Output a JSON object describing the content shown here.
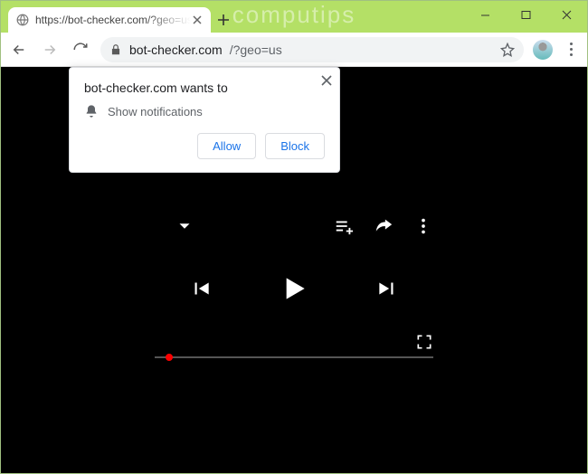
{
  "window": {
    "watermark": "computips"
  },
  "tab": {
    "title": "https://bot-checker.com/?geo=us"
  },
  "address": {
    "host": "bot-checker.com",
    "path": "/?geo=us"
  },
  "prompt": {
    "origin": "bot-checker.com wants to",
    "permission": "Show notifications",
    "allow_label": "Allow",
    "block_label": "Block"
  }
}
